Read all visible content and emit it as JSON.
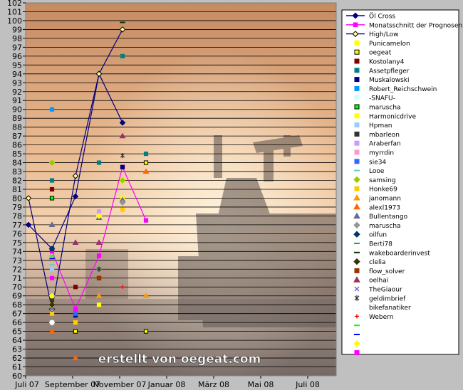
{
  "chart_data": {
    "type": "line",
    "watermark": "erstellt von oegeat.com",
    "x_tick_labels": [
      "Juli 07",
      "September 07",
      "November 07",
      "Januar 08",
      "März 08",
      "Mai 08",
      "Juli 08"
    ],
    "y_ticks": [
      60,
      61,
      62,
      63,
      64,
      65,
      66,
      67,
      68,
      69,
      70,
      71,
      72,
      73,
      74,
      75,
      76,
      77,
      78,
      79,
      80,
      81,
      82,
      83,
      84,
      85,
      86,
      87,
      88,
      89,
      90,
      91,
      92,
      93,
      94,
      95,
      96,
      97,
      98,
      99,
      100,
      101,
      102
    ],
    "ylim": [
      60,
      102
    ],
    "grid": true,
    "legend_position": "right",
    "x_slots": 14,
    "lines": [
      {
        "name": "Öl Cross",
        "color": "#000080",
        "marker": "diamond",
        "points": [
          [
            0,
            77
          ],
          [
            1,
            74.3
          ],
          [
            2,
            80.2
          ],
          [
            3,
            94
          ],
          [
            4,
            88.5
          ]
        ]
      },
      {
        "name": "Monatsschnitt der Prognosen",
        "color": "#ff00ff",
        "marker": "square",
        "points": [
          [
            1,
            74
          ],
          [
            2,
            67.5
          ],
          [
            3,
            73.5
          ],
          [
            4,
            83.5
          ],
          [
            5,
            77.5
          ]
        ]
      },
      {
        "name": "High/Low",
        "color": "#000080",
        "marker": "diamond-open",
        "points": [
          [
            0,
            80
          ],
          [
            1,
            67.5
          ],
          [
            2,
            82.5
          ],
          [
            3,
            94
          ],
          [
            4,
            99
          ]
        ]
      }
    ],
    "forecasts": [
      {
        "name": "Punicamelon",
        "color": "#ffff00",
        "shape": "square",
        "points": [
          [
            1,
            68
          ],
          [
            3,
            68
          ],
          [
            4,
            80
          ]
        ]
      },
      {
        "name": "oegeat",
        "color": "#ffff00",
        "shape": "square-open",
        "points": [
          [
            2,
            65
          ],
          [
            5,
            84
          ],
          [
            5,
            65
          ]
        ]
      },
      {
        "name": "Kostolany4",
        "color": "#800000",
        "shape": "square",
        "points": [
          [
            1,
            81
          ],
          [
            2,
            70
          ],
          [
            3,
            71
          ]
        ]
      },
      {
        "name": "Assetpfleger",
        "color": "#008080",
        "shape": "square",
        "points": [
          [
            1,
            82
          ],
          [
            3,
            84
          ],
          [
            4,
            96
          ],
          [
            5,
            85
          ]
        ]
      },
      {
        "name": "Muskalowski",
        "color": "#000080",
        "shape": "square",
        "points": [
          [
            1,
            74.3
          ],
          [
            2,
            66.8
          ],
          [
            4,
            83.5
          ]
        ]
      },
      {
        "name": "Robert_Reichschwein",
        "color": "#0099ff",
        "shape": "square",
        "points": [
          [
            1,
            90
          ]
        ]
      },
      {
        "name": "-SNAFU-",
        "color": "#ccffff",
        "shape": "square",
        "points": [
          [
            1,
            66
          ]
        ]
      },
      {
        "name": "maruscha",
        "color": "#00ff00",
        "shape": "square-open",
        "points": [
          [
            1,
            80
          ]
        ]
      },
      {
        "name": "Harmonicdrive",
        "color": "#ffff00",
        "shape": "square",
        "points": [
          [
            1,
            68.7
          ],
          [
            4,
            82
          ]
        ]
      },
      {
        "name": "Hpman",
        "color": "#99ccff",
        "shape": "square",
        "points": [
          [
            1,
            72
          ]
        ]
      },
      {
        "name": "mbarleon",
        "color": "#333333",
        "shape": "square",
        "points": [
          [
            1,
            68.5
          ]
        ]
      },
      {
        "name": "Araberfan",
        "color": "#cc99ff",
        "shape": "square",
        "points": [
          [
            3,
            78.5
          ]
        ]
      },
      {
        "name": "myrrdin",
        "color": "#ff99cc",
        "shape": "square",
        "points": [
          [
            1,
            71
          ]
        ]
      },
      {
        "name": "sie34",
        "color": "#3366ff",
        "shape": "square",
        "points": [
          [
            2,
            67
          ]
        ]
      },
      {
        "name": "Looe",
        "color": "#66cccc",
        "shape": "dash",
        "points": [
          [
            1,
            72.5
          ]
        ]
      },
      {
        "name": "samsing",
        "color": "#99cc00",
        "shape": "diamond",
        "points": [
          [
            1,
            84
          ],
          [
            4,
            82
          ]
        ]
      },
      {
        "name": "Honke69",
        "color": "#ffcc00",
        "shape": "square",
        "points": [
          [
            1,
            67
          ],
          [
            2,
            66
          ],
          [
            4,
            78.7
          ]
        ]
      },
      {
        "name": "janomann",
        "color": "#ff9900",
        "shape": "triangle",
        "points": [
          [
            3,
            69
          ],
          [
            5,
            69
          ]
        ]
      },
      {
        "name": "alexl1973",
        "color": "#ff6600",
        "shape": "triangle",
        "points": [
          [
            1,
            65
          ],
          [
            2,
            62
          ],
          [
            5,
            83
          ]
        ]
      },
      {
        "name": "Bullentango",
        "color": "#666699",
        "shape": "triangle",
        "points": [
          [
            1,
            77
          ],
          [
            3,
            77.8
          ],
          [
            4,
            79.8
          ]
        ]
      },
      {
        "name": "maruscha",
        "color": "#969696",
        "shape": "diamond",
        "points": [
          [
            4,
            79.5
          ]
        ]
      },
      {
        "name": "oilfun",
        "color": "#003366",
        "shape": "diamond",
        "points": [
          [
            1,
            74.3
          ]
        ]
      },
      {
        "name": "Berti78",
        "color": "#339966",
        "shape": "dash",
        "points": [
          [
            3,
            72
          ]
        ]
      },
      {
        "name": "wakeboarderinvest",
        "color": "#003300",
        "shape": "dash",
        "points": [
          [
            4,
            99.8
          ]
        ]
      },
      {
        "name": "clelia",
        "color": "#333300",
        "shape": "diamond",
        "points": [
          [
            1,
            68
          ]
        ]
      },
      {
        "name": "flow_solver",
        "color": "#993300",
        "shape": "square",
        "points": [
          [
            3,
            71
          ]
        ]
      },
      {
        "name": "oelhai",
        "color": "#993366",
        "shape": "triangle",
        "points": [
          [
            2,
            75
          ],
          [
            3,
            75
          ],
          [
            4,
            87
          ]
        ]
      },
      {
        "name": "TheGiaour",
        "color": "#6666cc",
        "shape": "x",
        "points": [
          [
            1,
            67.5
          ]
        ]
      },
      {
        "name": "geldimbrief",
        "color": "#333333",
        "shape": "star",
        "points": [
          [
            3,
            72
          ],
          [
            4,
            84.8
          ]
        ]
      },
      {
        "name": "bikefanatiker",
        "color": "#ffffff",
        "shape": "diamond",
        "points": [
          [
            1,
            66
          ]
        ]
      },
      {
        "name": "Webern",
        "color": "#ff0000",
        "shape": "plus",
        "points": [
          [
            4,
            70
          ]
        ]
      },
      {
        "name": "",
        "color": "#00ff00",
        "shape": "dash",
        "points": [
          [
            1,
            73.5
          ]
        ]
      },
      {
        "name": "",
        "color": "#0000ff",
        "shape": "dash",
        "points": [
          [
            1,
            73.2
          ]
        ]
      },
      {
        "name": "",
        "color": "#ffff00",
        "shape": "diamond",
        "points": [
          [
            1,
            69
          ],
          [
            3,
            78
          ]
        ]
      },
      {
        "name": "",
        "color": "#ff00ff",
        "shape": "square",
        "points": [
          [
            1,
            71
          ]
        ]
      }
    ]
  }
}
